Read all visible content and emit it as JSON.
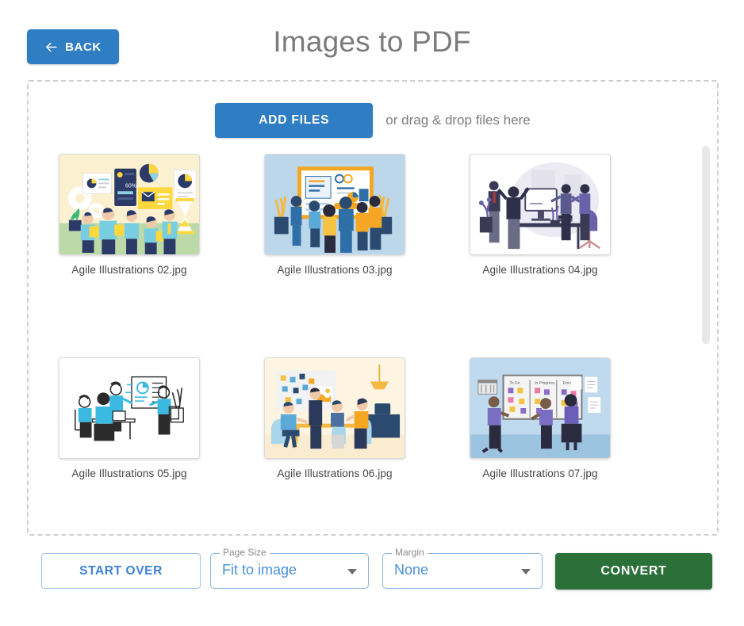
{
  "header": {
    "back_label": "BACK",
    "back_icon": "arrow-left-icon",
    "title": "Images to PDF",
    "accent_blue": "#2f7dc2",
    "title_color": "#7b7b7b"
  },
  "dropzone": {
    "add_files_label": "ADD FILES",
    "drag_hint": "or drag & drop files here",
    "border_color": "#cfcfcf"
  },
  "files": [
    {
      "name": "Agile Illustrations 02.jpg",
      "thumb": "agile-02"
    },
    {
      "name": "Agile Illustrations 03.jpg",
      "thumb": "agile-03"
    },
    {
      "name": "Agile Illustrations 04.jpg",
      "thumb": "agile-04"
    },
    {
      "name": "Agile Illustrations 05.jpg",
      "thumb": "agile-05"
    },
    {
      "name": "Agile Illustrations 06.jpg",
      "thumb": "agile-06"
    },
    {
      "name": "Agile Illustrations 07.jpg",
      "thumb": "agile-07"
    }
  ],
  "kanban_thumb_labels": {
    "todo": "To Do",
    "in_progress": "In Progress",
    "done": "Done"
  },
  "scrollbar": {
    "thumb_color": "#e8e8e6"
  },
  "bottom_bar": {
    "start_over_label": "START OVER",
    "page_size": {
      "legend": "Page Size",
      "value": "Fit to image",
      "caret_icon": "chevron-down-icon"
    },
    "margin": {
      "legend": "Margin",
      "value": "None",
      "caret_icon": "chevron-down-icon"
    },
    "convert_label": "CONVERT",
    "convert_color": "#2a7038",
    "outline_color": "#8ab6e0",
    "value_color": "#4a90d9"
  }
}
